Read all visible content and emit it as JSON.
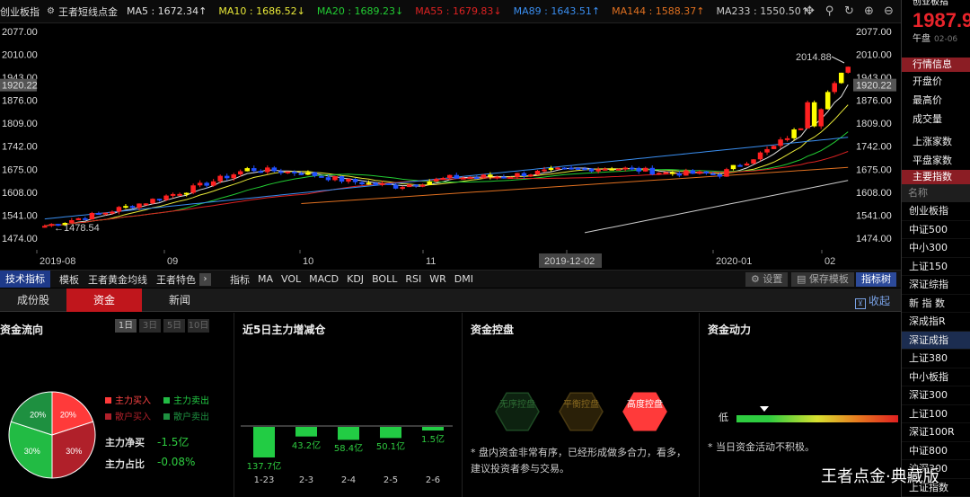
{
  "ma_bar": {
    "index_name": "创业板指",
    "indicator_name": "王者短线点金",
    "ma": [
      {
        "label": "MA5 : 1672.34↑",
        "color": "#e0e0e0"
      },
      {
        "label": "MA10 : 1686.52↓",
        "color": "#e8e838"
      },
      {
        "label": "MA20 : 1689.23↓",
        "color": "#22cc33"
      },
      {
        "label": "MA55 : 1679.83↓",
        "color": "#dd2222"
      },
      {
        "label": "MA89 : 1643.51↑",
        "color": "#3a8ef0"
      },
      {
        "label": "MA144 : 1588.37↑",
        "color": "#e07020"
      },
      {
        "label": "MA233 : 1550.50↑",
        "color": "#cccccc"
      }
    ],
    "tools": [
      {
        "name": "move-icon",
        "glyph": "✥"
      },
      {
        "name": "zoom-icon",
        "glyph": "⚲"
      },
      {
        "name": "refresh-icon",
        "glyph": "↻"
      },
      {
        "name": "zoom-in-icon",
        "glyph": "⊕"
      },
      {
        "name": "zoom-out-icon",
        "glyph": "⊖"
      }
    ]
  },
  "chart_data": {
    "type": "candlestick",
    "y_ticks_left": [
      "2077.00",
      "2010.00",
      "1943.00",
      "1876.00",
      "1809.00",
      "1742.00",
      "1675.00",
      "1608.00",
      "1541.00",
      "1474.00"
    ],
    "y_ticks_right": [
      "2077.00",
      "2010.00",
      "1943.00",
      "1876.00",
      "1809.00",
      "1742.00",
      "1675.00",
      "1608.00",
      "1541.00",
      "1474.00"
    ],
    "ylim": [
      1440,
      2100
    ],
    "cursor_value": "1920.22",
    "max_label": "2014.88",
    "min_label": "1478.54",
    "x_labels": [
      "2019-08",
      "09",
      "10",
      "11",
      "2019-12-02",
      "2020-01",
      "02"
    ],
    "highlight_x_label": "2019-12-02",
    "ma_colors": {
      "ma5": "#e0e0e0",
      "ma10": "#e8e838",
      "ma20": "#22cc33",
      "ma55": "#dd2222",
      "ma89": "#3a8ef0",
      "ma144": "#e07020",
      "ma233": "#cccccc"
    },
    "up_color": "#ff2020",
    "down_color": "#2050ff",
    "signal_color": "#ffff00",
    "grid": false
  },
  "indicator_bar": {
    "tech_label": "技术指标",
    "items": [
      "模板",
      "王者黄金均线",
      "王者特色"
    ],
    "label": "指标",
    "indicators": [
      "MA",
      "VOL",
      "MACD",
      "KDJ",
      "BOLL",
      "RSI",
      "WR",
      "DMI"
    ],
    "settings": "设置",
    "save_template": "保存模板",
    "indicator_tree": "指标树"
  },
  "tabs": {
    "items": [
      "成份股",
      "资金",
      "新闻"
    ],
    "active": 1,
    "collapse": "收起"
  },
  "flow": {
    "title": "资金流向",
    "days": [
      "1日",
      "3日",
      "5日",
      "10日"
    ],
    "pie": [
      {
        "label": "主力买入",
        "value": 20,
        "color": "#ff3a3a"
      },
      {
        "label": "主力卖出",
        "value": 30,
        "color": "#22bb44"
      },
      {
        "label": "散户买入",
        "value": 30,
        "color": "#b0202a"
      },
      {
        "label": "散户卖出",
        "value": 20,
        "color": "#1e9040"
      }
    ],
    "pie_labels": [
      "20%",
      "20%",
      "30%",
      "30%"
    ],
    "net_label": "主力净买",
    "net_value": "-1.5亿",
    "ratio_label": "主力占比",
    "ratio_value": "-0.08%"
  },
  "increase": {
    "title": "近5日主力增减仓",
    "bars": [
      {
        "date": "1-23",
        "value": -137.7,
        "label": "137.7亿"
      },
      {
        "date": "2-3",
        "value": -43.2,
        "label": "43.2亿"
      },
      {
        "date": "2-4",
        "value": -58.4,
        "label": "58.4亿"
      },
      {
        "date": "2-5",
        "value": -50.1,
        "label": "50.1亿"
      },
      {
        "date": "2-6",
        "value": -1.5,
        "label": "1.5亿"
      }
    ]
  },
  "control": {
    "title": "资金控盘",
    "hexes": [
      {
        "label": "无序控盘",
        "active": false
      },
      {
        "label": "平衡控盘",
        "active": false
      },
      {
        "label": "高度控盘",
        "active": true
      }
    ],
    "note": "* 盘内资金非常有序，已经形成做多合力，看多，建议投资者参与交易。"
  },
  "power": {
    "title": "资金动力",
    "low": "低",
    "note": "* 当日资金活动不积极。"
  },
  "sidebar": {
    "title": "创业板指",
    "price": "1987.9",
    "session": "午盘",
    "date": "02-06",
    "info_title": "行情信息",
    "info_rows": [
      "开盘价",
      "最高价",
      "成交量"
    ],
    "info_rows2": [
      "上涨家数",
      "平盘家数"
    ],
    "index_title": "主要指数",
    "list_head": "名称",
    "indices": [
      "创业板指",
      "中证500",
      "中小300",
      "上证150",
      "深证综指",
      "新 指 数",
      "深成指R",
      "深证成指",
      "上证380",
      "中小板指",
      "深证300",
      "上证100",
      "深证100R",
      "中证800",
      "沪深300",
      "上证指数"
    ],
    "active_index": 7
  },
  "watermark": "王者点金·典藏版"
}
